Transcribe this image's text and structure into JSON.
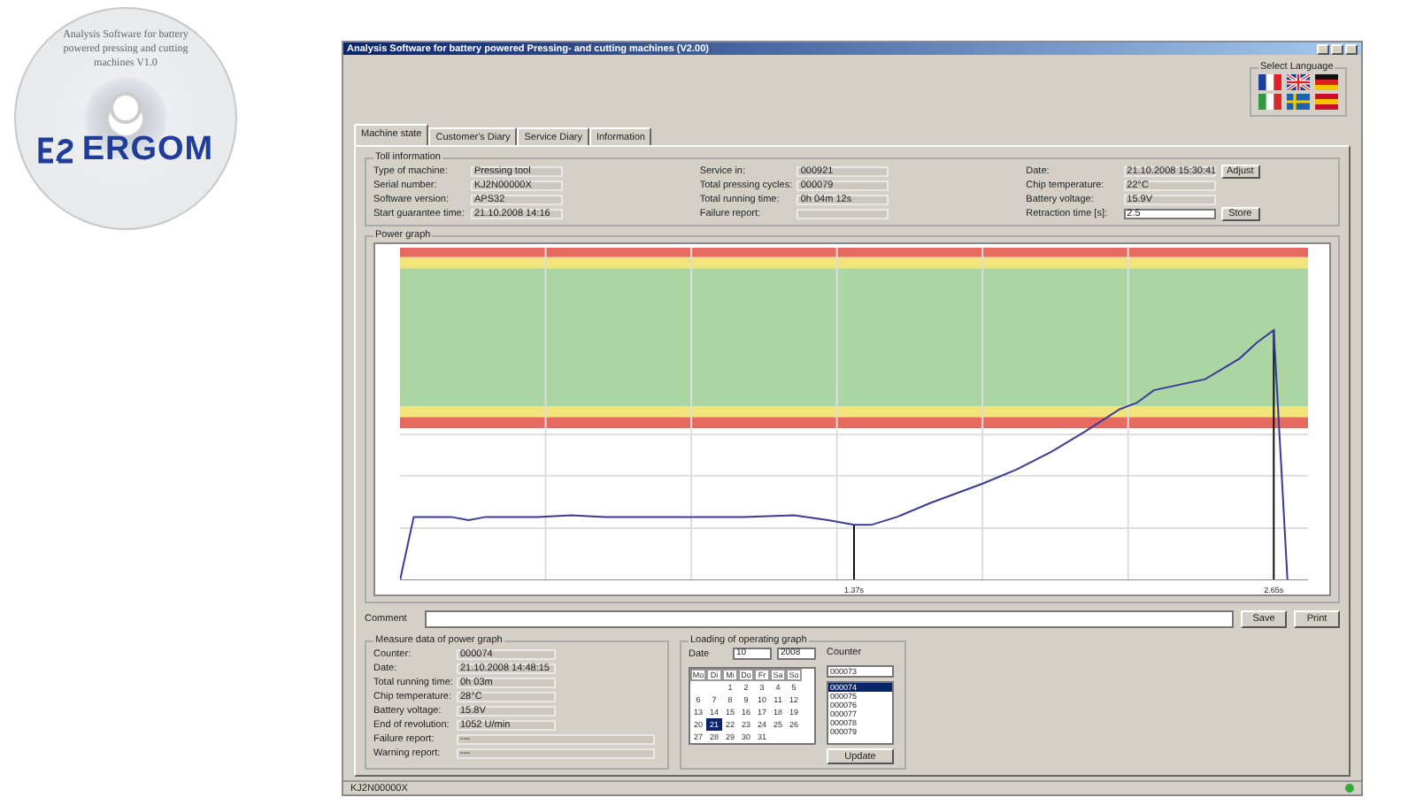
{
  "cd": {
    "text": "Analysis Software for battery powered pressing and cutting machines V1.0",
    "brand": "ERGOM"
  },
  "window": {
    "title": "Analysis Software for battery powered Pressing- and cutting machines (V2.00)"
  },
  "language": {
    "title": "Select Language"
  },
  "tabs": [
    {
      "label": "Machine state",
      "selected": true
    },
    {
      "label": "Customer's Diary",
      "selected": false
    },
    {
      "label": "Service Diary",
      "selected": false
    },
    {
      "label": "Information",
      "selected": false
    }
  ],
  "tool_info": {
    "title": "Toll information",
    "columns": [
      [
        {
          "label": "Type of machine:",
          "value": "Pressing tool"
        },
        {
          "label": "Serial number:",
          "value": "KJ2N00000X"
        },
        {
          "label": "Software version:",
          "value": "APS32"
        },
        {
          "label": "Start guarantee time:",
          "value": "21.10.2008 14:16"
        }
      ],
      [
        {
          "label": "Service in:",
          "value": "000921"
        },
        {
          "label": "Total pressing cycles:",
          "value": "000079"
        },
        {
          "label": "Total running time:",
          "value": "0h 04m 12s"
        },
        {
          "label": "Failure report:"
        }
      ],
      [
        {
          "label": "Date:",
          "value": "21.10.2008 15:30:41",
          "button": "Adjust"
        },
        {
          "label": "Chip temperature:",
          "value": "22°C"
        },
        {
          "label": "Battery voltage:",
          "value": "15.9V"
        },
        {
          "label": "Retraction time [s]:",
          "value": "2.5",
          "editable": true,
          "button": "Store"
        }
      ]
    ]
  },
  "power_graph": {
    "title": "Power graph",
    "markers": [
      {
        "label": "1.37s"
      },
      {
        "label": "2.65s"
      }
    ]
  },
  "comment": {
    "label": "Comment",
    "buttons": [
      "Save",
      "Print"
    ]
  },
  "measure": {
    "title": "Measure data of power graph",
    "fields": [
      {
        "label": "Counter:",
        "value": "000074"
      },
      {
        "label": "Date:",
        "value": "21.10.2008 14:48:15"
      },
      {
        "label": "Total running time:",
        "value": "0h 03m"
      },
      {
        "label": "Chip temperature:",
        "value": "28°C"
      },
      {
        "label": "Battery voltage:",
        "value": "15.8V"
      },
      {
        "label": "End of revolution:",
        "value": "1052 U/min"
      },
      {
        "label": "Failure report:",
        "value": "---",
        "wide": true
      },
      {
        "label": "Warning report:",
        "value": "---",
        "wide": true
      }
    ]
  },
  "loading": {
    "title": "Loading of operating graph",
    "date_label": "Date",
    "month": "10",
    "year": "2008",
    "weekdays": [
      "Mo",
      "Di",
      "Mi",
      "Do",
      "Fr",
      "Sa",
      "So"
    ],
    "weeks": [
      {
        "days": [
          {
            "label": "1",
            "selected": false
          },
          {
            "label": "2",
            "selected": false
          },
          {
            "label": "3",
            "selected": false
          },
          {
            "label": "4",
            "selected": false
          },
          {
            "label": "5",
            "selected": false
          }
        ]
      },
      {
        "days": [
          {
            "label": "6",
            "selected": false
          },
          {
            "label": "7",
            "selected": false
          },
          {
            "label": "8",
            "selected": false
          },
          {
            "label": "9",
            "selected": false
          },
          {
            "label": "10",
            "selected": false
          },
          {
            "label": "11",
            "selected": false
          },
          {
            "label": "12",
            "selected": false
          }
        ]
      },
      {
        "days": [
          {
            "label": "13",
            "selected": false
          },
          {
            "label": "14",
            "selected": false
          },
          {
            "label": "15",
            "selected": false
          },
          {
            "label": "16",
            "selected": false
          },
          {
            "label": "17",
            "selected": false
          },
          {
            "label": "18",
            "selected": false
          },
          {
            "label": "19",
            "selected": false
          }
        ]
      },
      {
        "days": [
          {
            "label": "20",
            "selected": false
          },
          {
            "label": "21",
            "selected": true
          },
          {
            "label": "22",
            "selected": false
          },
          {
            "label": "23",
            "selected": false
          },
          {
            "label": "24",
            "selected": false
          },
          {
            "label": "25",
            "selected": false
          },
          {
            "label": "26",
            "selected": false
          }
        ]
      },
      {
        "days": [
          {
            "label": "27",
            "selected": false
          },
          {
            "label": "28",
            "selected": false
          },
          {
            "label": "29",
            "selected": false
          },
          {
            "label": "30",
            "selected": false
          },
          {
            "label": "31",
            "selected": false
          }
        ]
      }
    ],
    "counter_label": "Counter",
    "counter_value": "000073",
    "counters": [
      {
        "label": "000074",
        "selected": true
      },
      {
        "label": "000075",
        "selected": false
      },
      {
        "label": "000076",
        "selected": false
      },
      {
        "label": "000077",
        "selected": false
      },
      {
        "label": "000078",
        "selected": false
      },
      {
        "label": "000079",
        "selected": false
      }
    ],
    "update": "Update"
  },
  "status_bar": {
    "text": "KJ2N00000X"
  }
}
